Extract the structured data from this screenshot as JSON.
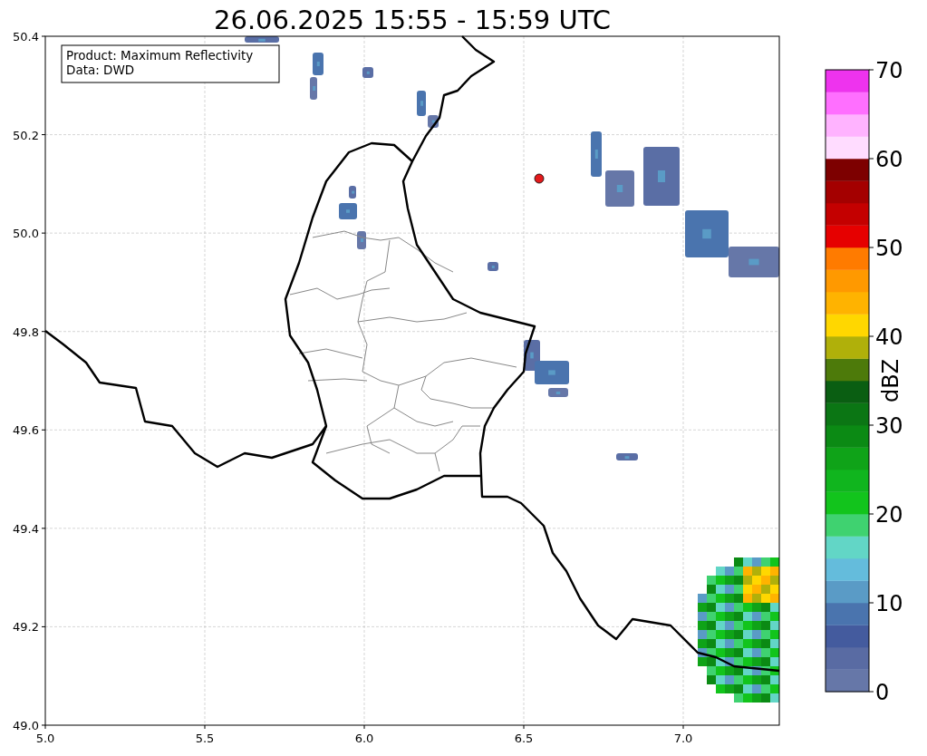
{
  "title": "26.06.2025 15:55 - 15:59 UTC",
  "map": {
    "info_box": [
      "Product: Maximum Reflectivity",
      "Data: DWD"
    ],
    "xticks": [
      "5.0",
      "5.5",
      "6.0",
      "6.5",
      "7.0"
    ],
    "yticks": [
      "50.4",
      "50.2",
      "50.0",
      "49.8",
      "49.6",
      "49.4",
      "49.2",
      "49.0"
    ]
  },
  "colorbar": {
    "label": "dBZ",
    "ticks": [
      "70",
      "60",
      "50",
      "40",
      "30",
      "20",
      "10",
      "0"
    ],
    "bins": [
      {
        "color": "#6677a8"
      },
      {
        "color": "#596ba3"
      },
      {
        "color": "#445b9e"
      },
      {
        "color": "#4a74ae"
      },
      {
        "color": "#5a9bc6"
      },
      {
        "color": "#64bcdc"
      },
      {
        "color": "#62d6c6"
      },
      {
        "color": "#3fd270"
      },
      {
        "color": "#12c41c"
      },
      {
        "color": "#10b51e"
      },
      {
        "color": "#0fa318"
      },
      {
        "color": "#0b8a14"
      },
      {
        "color": "#0b7614"
      },
      {
        "color": "#0a5e12"
      },
      {
        "color": "#4d7a0a"
      },
      {
        "color": "#b0b00a"
      },
      {
        "color": "#ffd700"
      },
      {
        "color": "#ffb300"
      },
      {
        "color": "#ff9900"
      },
      {
        "color": "#ff7b00"
      },
      {
        "color": "#e60000"
      },
      {
        "color": "#c40000"
      },
      {
        "color": "#a40000"
      },
      {
        "color": "#7d0000"
      },
      {
        "color": "#ffdcff"
      },
      {
        "color": "#ffb3ff"
      },
      {
        "color": "#ff6fff"
      },
      {
        "color": "#ee33ee"
      }
    ]
  }
}
